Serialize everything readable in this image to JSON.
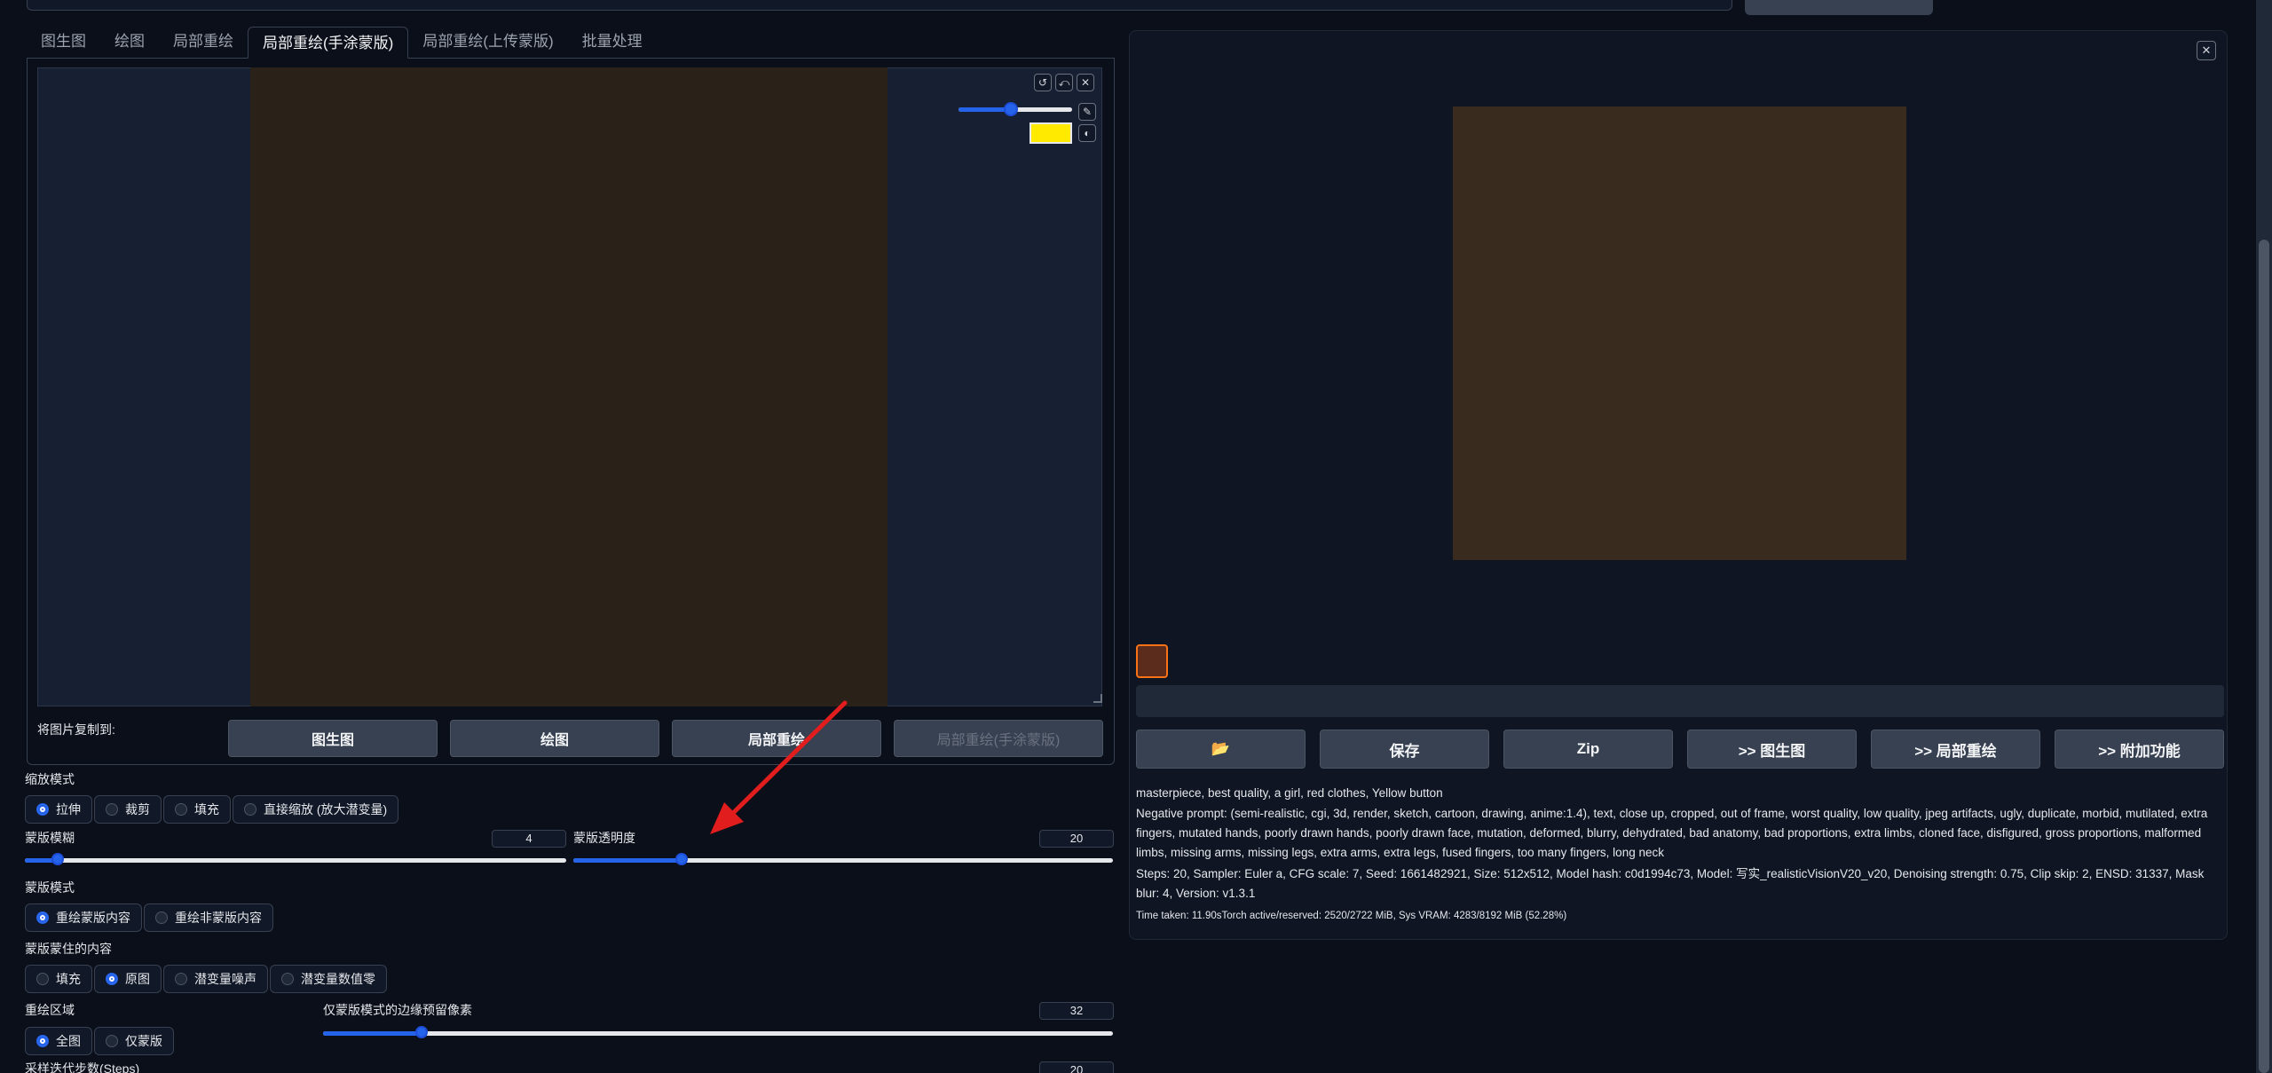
{
  "tabs": [
    "图生图",
    "绘图",
    "局部重绘",
    "局部重绘(手涂蒙版)",
    "局部重绘(上传蒙版)",
    "批量处理"
  ],
  "active_tab": "局部重绘(手涂蒙版)",
  "canvas": {
    "tools": [
      "↺",
      "⤺",
      "✕"
    ],
    "brush_size_fraction": 0.45,
    "brush_color": "#ffea00"
  },
  "copy_to": {
    "label": "将图片复制到:",
    "buttons": [
      "图生图",
      "绘图",
      "局部重绘",
      "局部重绘(手涂蒙版)"
    ]
  },
  "resize_mode": {
    "label": "缩放模式",
    "options": [
      "拉伸",
      "裁剪",
      "填充",
      "直接缩放 (放大潜变量)"
    ],
    "selected": "拉伸"
  },
  "mask_blur": {
    "label": "蒙版模糊",
    "value": "4",
    "fraction": 0.06
  },
  "mask_transparency": {
    "label": "蒙版透明度",
    "value": "20",
    "fraction": 0.2
  },
  "mask_mode": {
    "label": "蒙版模式",
    "options": [
      "重绘蒙版内容",
      "重绘非蒙版内容"
    ],
    "selected": "重绘蒙版内容"
  },
  "masked_content": {
    "label": "蒙版蒙住的内容",
    "options": [
      "填充",
      "原图",
      "潜变量噪声",
      "潜变量数值零"
    ],
    "selected": "原图"
  },
  "inpaint_area": {
    "label": "重绘区域",
    "options": [
      "全图",
      "仅蒙版"
    ],
    "selected": "全图"
  },
  "padding": {
    "label": "仅蒙版模式的边缘预留像素",
    "value": "32",
    "fraction": 0.125
  },
  "steps": {
    "label": "采样迭代步数(Steps)",
    "value": "20"
  },
  "result": {
    "close": "✕",
    "buttons": [
      "📂",
      "保存",
      "Zip",
      ">> 图生图",
      ">> 局部重绘",
      ">> 附加功能"
    ],
    "prompt": "masterpiece, best quality, a girl, red clothes, Yellow button",
    "negative": "Negative prompt: (semi-realistic, cgi, 3d, render, sketch, cartoon, drawing, anime:1.4), text, close up, cropped, out of frame, worst quality, low quality, jpeg artifacts, ugly, duplicate, morbid, mutilated, extra fingers, mutated hands, poorly drawn hands, poorly drawn face, mutation, deformed, blurry, dehydrated, bad anatomy, bad proportions, extra limbs, cloned face, disfigured, gross proportions, malformed limbs, missing arms, missing legs, extra arms, extra legs, fused fingers, too many fingers, long neck",
    "params": "Steps: 20, Sampler: Euler a, CFG scale: 7, Seed: 1661482921, Size: 512x512, Model hash: c0d1994c73, Model: 写实_realisticVisionV20_v20, Denoising strength: 0.75, Clip skip: 2, ENSD: 31337, Mask blur: 4, Version: v1.3.1",
    "time": "Time taken: 11.90sTorch active/reserved: 2520/2722 MiB, Sys VRAM: 4283/8192 MiB (52.28%)"
  },
  "colors": {
    "accent": "#2563eb",
    "arrow": "#e11d1d",
    "bg": "#0b0f19"
  }
}
